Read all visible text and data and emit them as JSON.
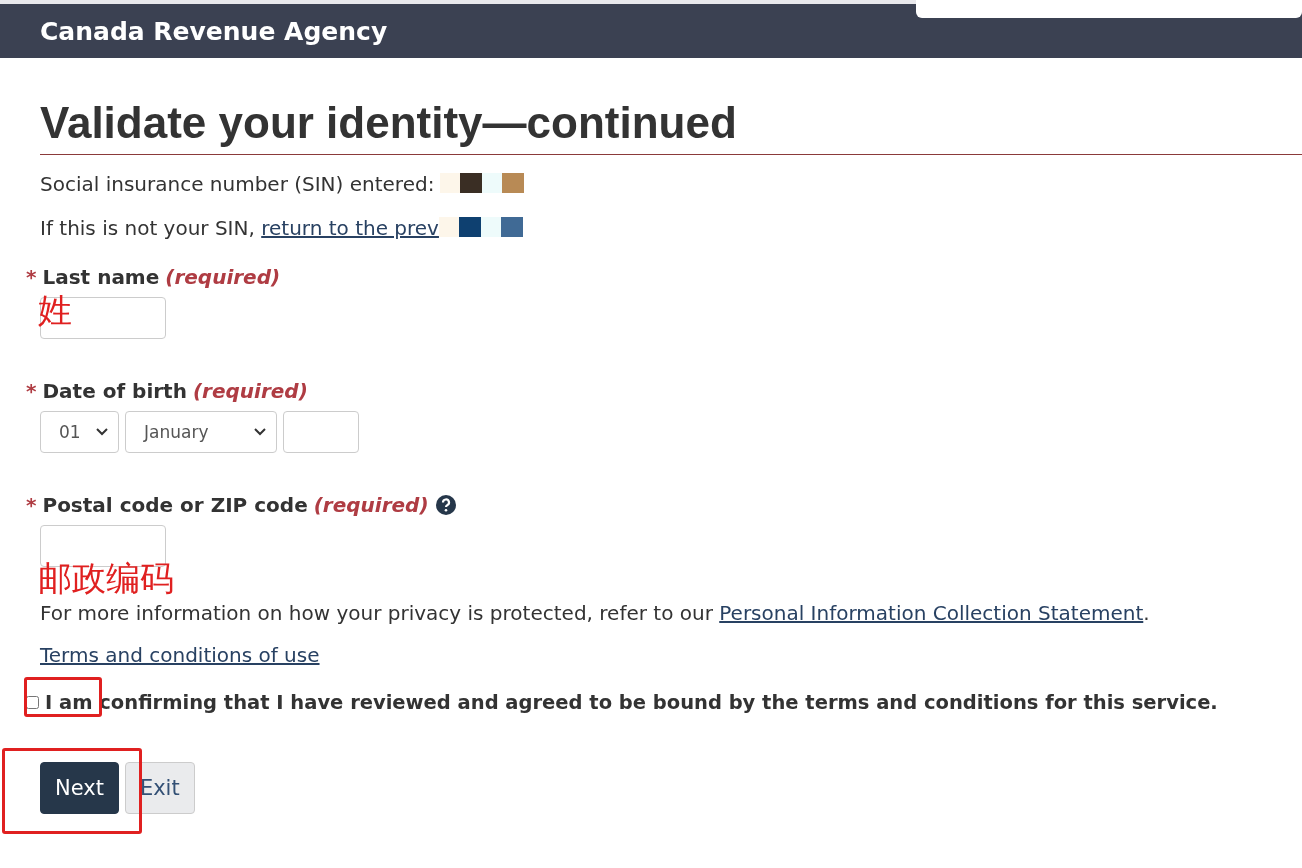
{
  "header": {
    "title": "Canada Revenue Agency"
  },
  "heading": "Validate your identity—continued",
  "sin": {
    "label": "Social insurance number (SIN) entered:",
    "redacted": true
  },
  "not_your_sin": {
    "text": "If this is not your SIN,",
    "link": "return to the prev",
    "redacted": true
  },
  "fields": [
    {
      "kind": "text",
      "asterisk": "*",
      "label": "Last name",
      "required": "(required)",
      "annotation": "姓"
    },
    {
      "kind": "date",
      "asterisk": "*",
      "label": "Date of birth",
      "required": "(required)",
      "day": "01",
      "month": "January"
    },
    {
      "kind": "text",
      "asterisk": "*",
      "label": "Postal code or ZIP code",
      "required": "(required)",
      "help": true,
      "annotation": "邮政编码"
    }
  ],
  "privacy": {
    "text": "For more information on how your privacy is protected, refer to our",
    "link": "Personal Information Collection Statement",
    "end": "."
  },
  "terms_link": "Terms and conditions of use",
  "agreement": {
    "checked": false,
    "label": "I am confirming that I have reviewed and agreed to be bound by the terms and conditions for this service.",
    "highlighted": true
  },
  "buttons": [
    {
      "label": "Next",
      "kind": "primary"
    },
    {
      "label": "Exit",
      "kind": "secondary"
    }
  ],
  "buttons_highlighted": true
}
